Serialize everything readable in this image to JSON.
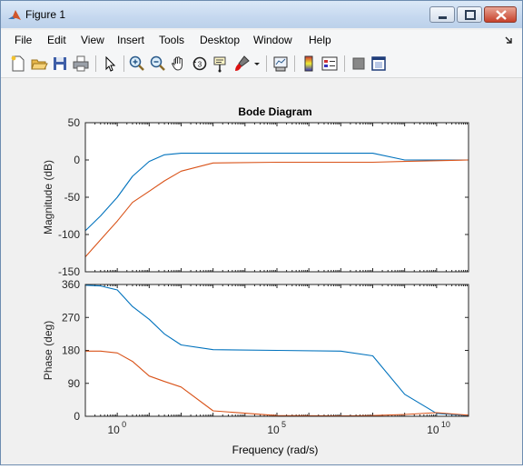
{
  "window": {
    "title": "Figure 1"
  },
  "menu": [
    "File",
    "Edit",
    "View",
    "Insert",
    "Tools",
    "Desktop",
    "Window",
    "Help"
  ],
  "toolbar_icons": [
    "new-figure-icon",
    "open-file-icon",
    "save-icon",
    "print-icon",
    "pointer-icon",
    "zoom-in-icon",
    "zoom-out-icon",
    "pan-icon",
    "rotate-3d-icon",
    "data-cursor-icon",
    "brush-icon",
    "brush-dropdown-icon",
    "link-plot-icon",
    "colorbar-icon",
    "legend-icon",
    "hide-plot-tools-icon",
    "show-plot-tools-icon"
  ],
  "chart_data": {
    "type": "line",
    "title": "Bode Diagram",
    "xlabel": "Frequency  (rad/s)",
    "xscale": "log",
    "xlim": [
      0.1,
      100000000000
    ],
    "xticks": [
      {
        "value": 1,
        "label": "10",
        "exp": "0"
      },
      {
        "value": 100000,
        "label": "10",
        "exp": "5"
      },
      {
        "value": 10000000000,
        "label": "10",
        "exp": "10"
      }
    ],
    "panels": [
      {
        "name": "magnitude",
        "ylabel": "Magnitude (dB)",
        "ylim": [
          -150,
          50
        ],
        "yticks": [
          -150,
          -100,
          -50,
          0,
          50
        ],
        "series": [
          {
            "color": "#0072bd",
            "x": [
              0.1,
              0.3,
              1,
              3,
              10,
              30,
              100,
              1000,
              100000,
              10000000,
              100000000,
              1000000000,
              10000000000,
              100000000000
            ],
            "y": [
              -95,
              -75,
              -50,
              -22,
              -2,
              7,
              9,
              9,
              9,
              9,
              9,
              0,
              0,
              0
            ]
          },
          {
            "color": "#d95319",
            "x": [
              0.1,
              0.3,
              1,
              3,
              10,
              30,
              100,
              1000,
              100000,
              10000000,
              100000000,
              1000000000,
              10000000000,
              100000000000
            ],
            "y": [
              -130,
              -107,
              -82,
              -57,
              -42,
              -28,
              -15,
              -4,
              -3,
              -3,
              -3,
              -2,
              -1,
              0
            ]
          }
        ]
      },
      {
        "name": "phase",
        "ylabel": "Phase (deg)",
        "ylim": [
          0,
          360
        ],
        "yticks": [
          0,
          90,
          180,
          270,
          360
        ],
        "series": [
          {
            "color": "#0072bd",
            "x": [
              0.1,
              0.3,
              1,
              3,
              10,
              30,
              100,
              1000,
              100000,
              10000000,
              100000000,
              1000000000,
              10000000000,
              100000000000
            ],
            "y": [
              358,
              356,
              345,
              300,
              265,
              225,
              195,
              182,
              180,
              178,
              165,
              60,
              8,
              2
            ]
          },
          {
            "color": "#d95319",
            "x": [
              0.1,
              0.3,
              1,
              3,
              10,
              30,
              100,
              1000,
              100000,
              10000000,
              100000000,
              1000000000,
              10000000000,
              100000000000
            ],
            "y": [
              178,
              178,
              173,
              150,
              110,
              95,
              80,
              15,
              2,
              1,
              2,
              5,
              10,
              3
            ]
          }
        ]
      }
    ]
  }
}
